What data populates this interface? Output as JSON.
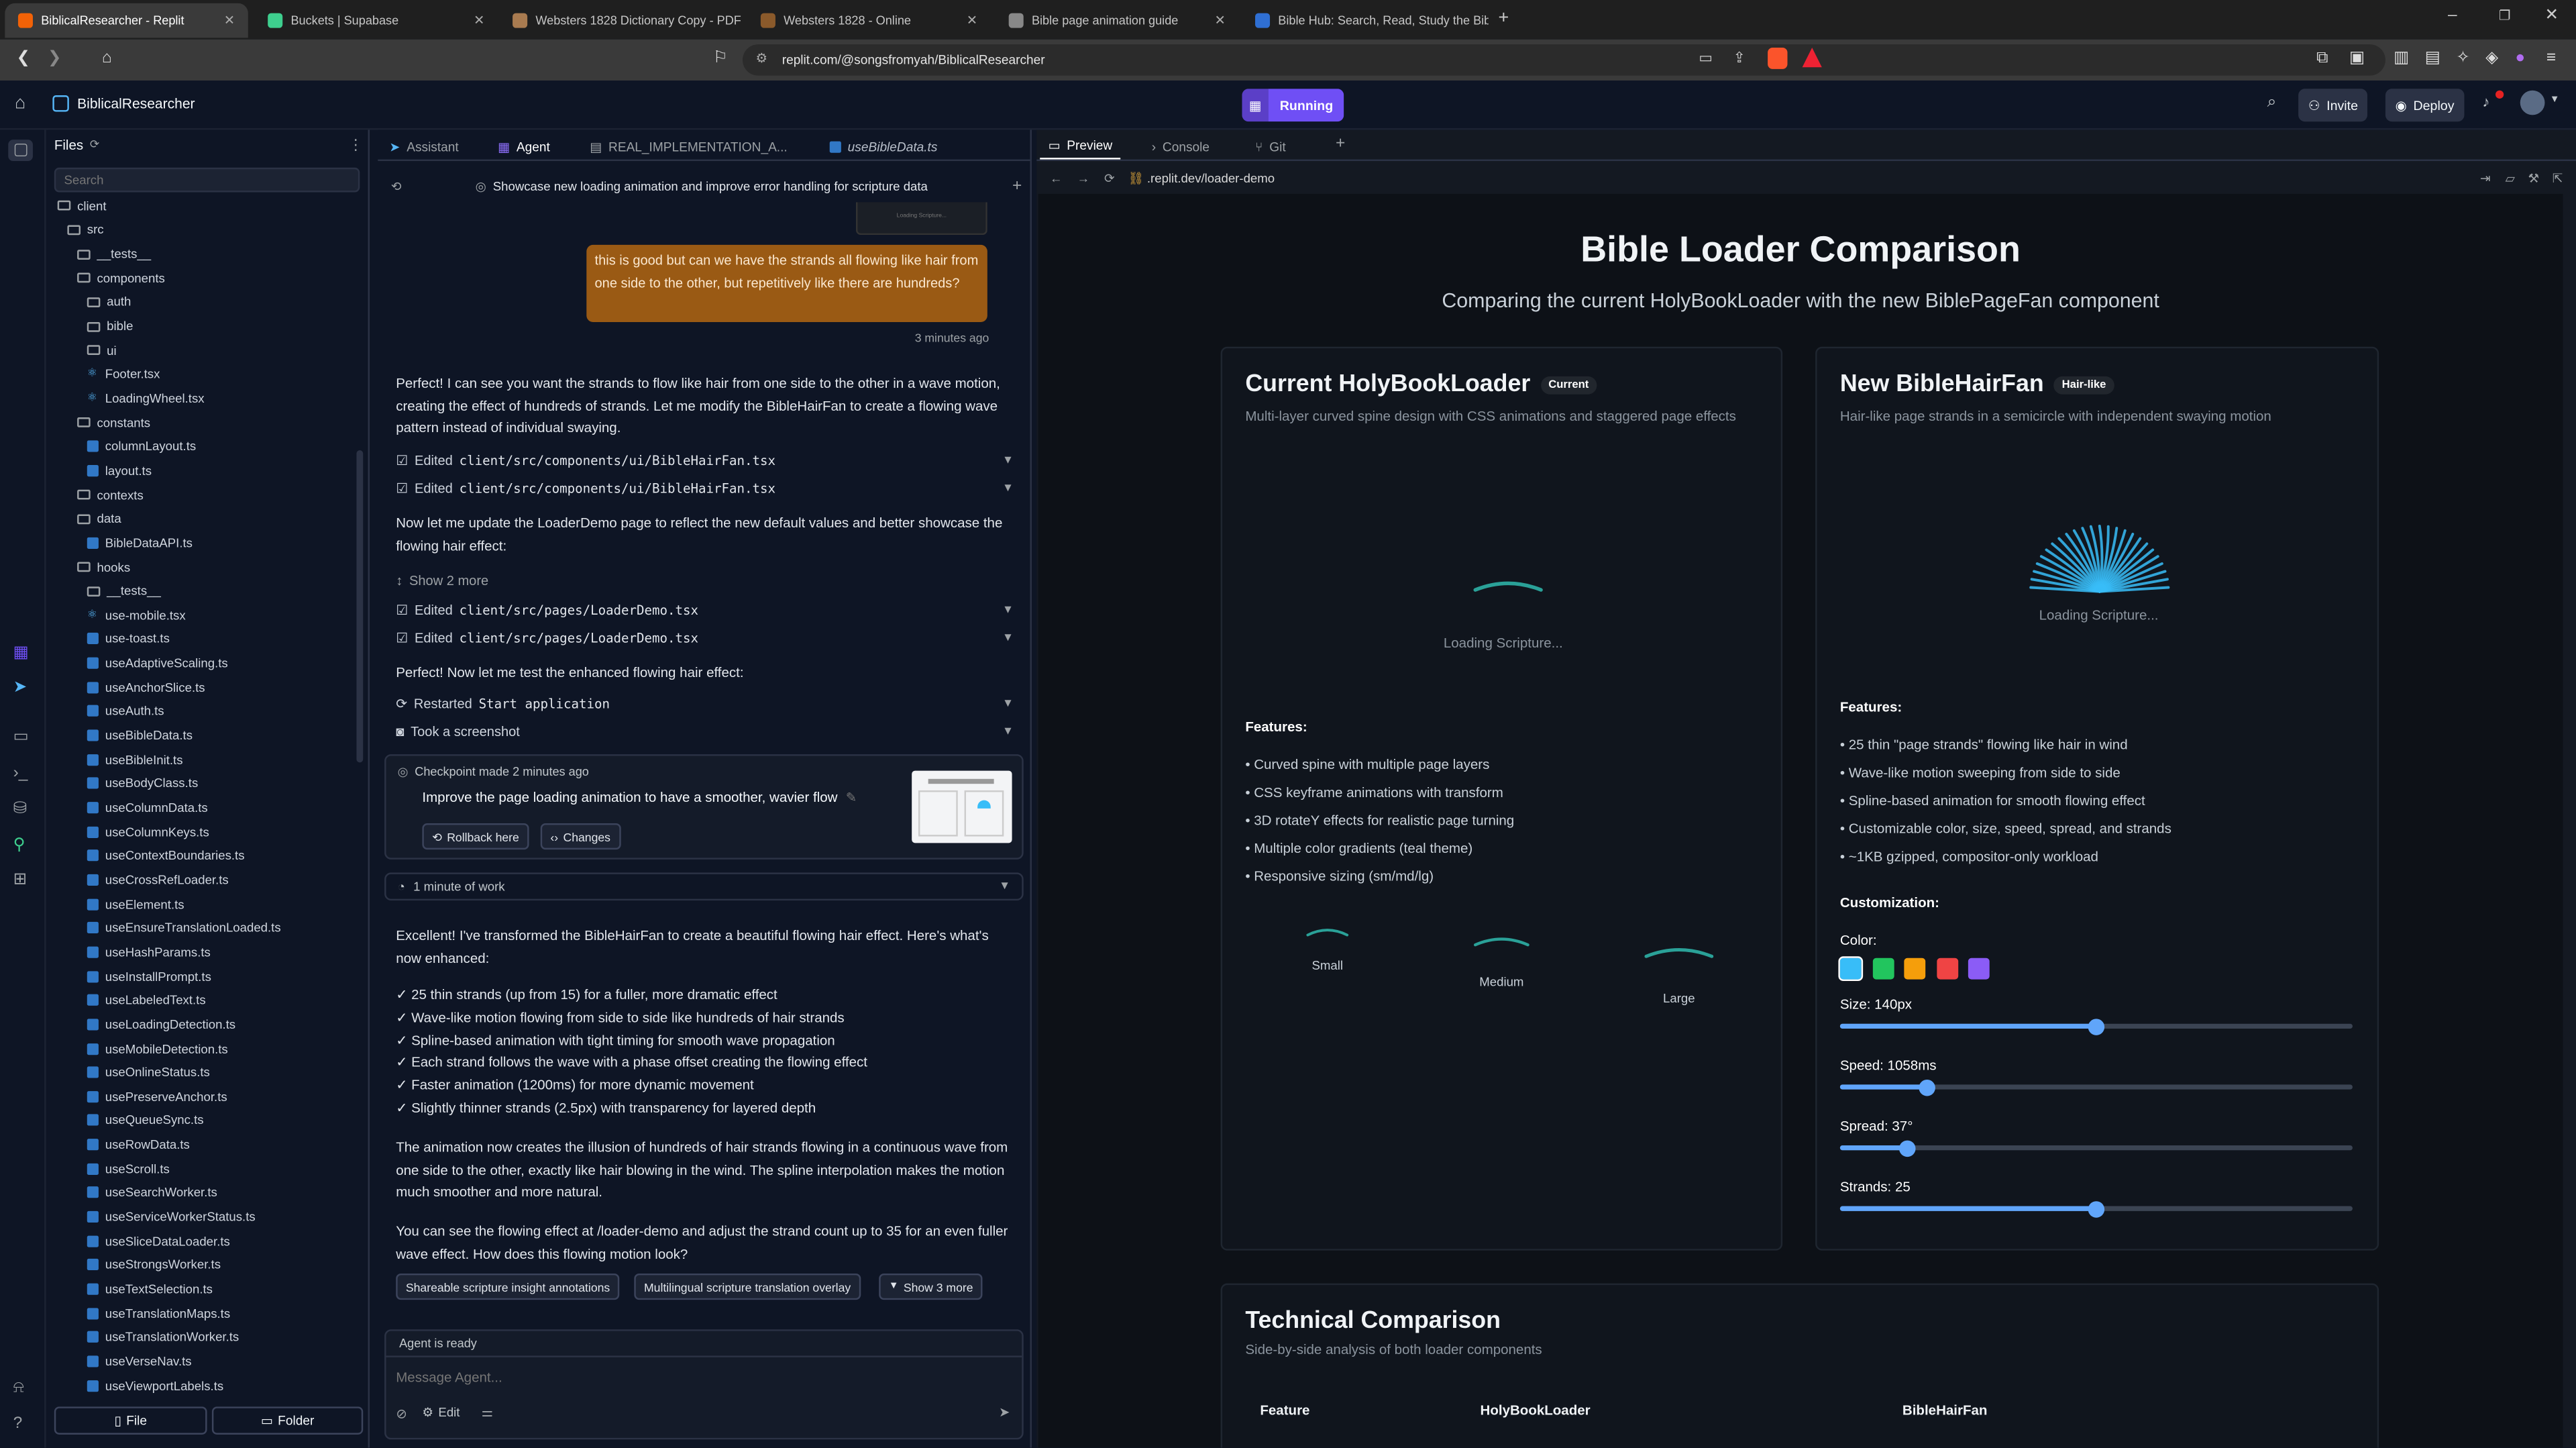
{
  "browser": {
    "tabs": [
      {
        "label": "BiblicalResearcher - Replit",
        "active": true,
        "color": "#f26207"
      },
      {
        "label": "Buckets | Supabase",
        "active": false,
        "color": "#3ecf8e"
      },
      {
        "label": "Websters 1828 Dictionary Copy - PDF",
        "active": false,
        "color": "#a97b50"
      },
      {
        "label": "Websters 1828 - Online",
        "active": false,
        "color": "#8b5a2b"
      },
      {
        "label": "Bible page animation guide",
        "active": false,
        "color": "#888888"
      },
      {
        "label": "Bible Hub: Search, Read, Study the Bible",
        "active": false,
        "color": "#2f6fd3"
      }
    ],
    "url": "replit.com/@songsfromyah/BiblicalResearcher"
  },
  "replit": {
    "project_name": "BiblicalResearcher",
    "run_label": "Running",
    "invite_label": "Invite",
    "deploy_label": "Deploy"
  },
  "files": {
    "title": "Files",
    "search_placeholder": "Search",
    "tree": [
      {
        "label": "client",
        "type": "folder",
        "depth": 0
      },
      {
        "label": "src",
        "type": "folder",
        "depth": 1
      },
      {
        "label": "__tests__",
        "type": "folder",
        "depth": 2
      },
      {
        "label": "components",
        "type": "folder",
        "depth": 2
      },
      {
        "label": "auth",
        "type": "folder",
        "depth": 3
      },
      {
        "label": "bible",
        "type": "folder",
        "depth": 3
      },
      {
        "label": "ui",
        "type": "folder",
        "depth": 3
      },
      {
        "label": "Footer.tsx",
        "type": "tsx",
        "depth": 3
      },
      {
        "label": "LoadingWheel.tsx",
        "type": "tsx",
        "depth": 3
      },
      {
        "label": "constants",
        "type": "folder",
        "depth": 2
      },
      {
        "label": "columnLayout.ts",
        "type": "ts",
        "depth": 3
      },
      {
        "label": "layout.ts",
        "type": "ts",
        "depth": 3
      },
      {
        "label": "contexts",
        "type": "folder",
        "depth": 2
      },
      {
        "label": "data",
        "type": "folder",
        "depth": 2
      },
      {
        "label": "BibleDataAPI.ts",
        "type": "ts",
        "depth": 3
      },
      {
        "label": "hooks",
        "type": "folder",
        "depth": 2
      },
      {
        "label": "__tests__",
        "type": "folder",
        "depth": 3
      },
      {
        "label": "use-mobile.tsx",
        "type": "tsx",
        "depth": 3
      },
      {
        "label": "use-toast.ts",
        "type": "ts",
        "depth": 3
      },
      {
        "label": "useAdaptiveScaling.ts",
        "type": "ts",
        "depth": 3
      },
      {
        "label": "useAnchorSlice.ts",
        "type": "ts",
        "depth": 3
      },
      {
        "label": "useAuth.ts",
        "type": "ts",
        "depth": 3
      },
      {
        "label": "useBibleData.ts",
        "type": "ts",
        "depth": 3
      },
      {
        "label": "useBibleInit.ts",
        "type": "ts",
        "depth": 3
      },
      {
        "label": "useBodyClass.ts",
        "type": "ts",
        "depth": 3
      },
      {
        "label": "useColumnData.ts",
        "type": "ts",
        "depth": 3
      },
      {
        "label": "useColumnKeys.ts",
        "type": "ts",
        "depth": 3
      },
      {
        "label": "useContextBoundaries.ts",
        "type": "ts",
        "depth": 3
      },
      {
        "label": "useCrossRefLoader.ts",
        "type": "ts",
        "depth": 3
      },
      {
        "label": "useElement.ts",
        "type": "ts",
        "depth": 3
      },
      {
        "label": "useEnsureTranslationLoaded.ts",
        "type": "ts",
        "depth": 3
      },
      {
        "label": "useHashParams.ts",
        "type": "ts",
        "depth": 3
      },
      {
        "label": "useInstallPrompt.ts",
        "type": "ts",
        "depth": 3
      },
      {
        "label": "useLabeledText.ts",
        "type": "ts",
        "depth": 3
      },
      {
        "label": "useLoadingDetection.ts",
        "type": "ts",
        "depth": 3
      },
      {
        "label": "useMobileDetection.ts",
        "type": "ts",
        "depth": 3
      },
      {
        "label": "useOnlineStatus.ts",
        "type": "ts",
        "depth": 3
      },
      {
        "label": "usePreserveAnchor.ts",
        "type": "ts",
        "depth": 3
      },
      {
        "label": "useQueueSync.ts",
        "type": "ts",
        "depth": 3
      },
      {
        "label": "useRowData.ts",
        "type": "ts",
        "depth": 3
      },
      {
        "label": "useScroll.ts",
        "type": "ts",
        "depth": 3
      },
      {
        "label": "useSearchWorker.ts",
        "type": "ts",
        "depth": 3
      },
      {
        "label": "useServiceWorkerStatus.ts",
        "type": "ts",
        "depth": 3
      },
      {
        "label": "useSliceDataLoader.ts",
        "type": "ts",
        "depth": 3
      },
      {
        "label": "useStrongsWorker.ts",
        "type": "ts",
        "depth": 3
      },
      {
        "label": "useTextSelection.ts",
        "type": "ts",
        "depth": 3
      },
      {
        "label": "useTranslationMaps.ts",
        "type": "ts",
        "depth": 3
      },
      {
        "label": "useTranslationWorker.ts",
        "type": "ts",
        "depth": 3
      },
      {
        "label": "useVerseNav.ts",
        "type": "ts",
        "depth": 3
      },
      {
        "label": "useViewportLabels.ts",
        "type": "ts",
        "depth": 3
      }
    ],
    "new_file_label": "File",
    "new_folder_label": "Folder"
  },
  "agent_panel": {
    "tabs": [
      "Assistant",
      "Agent",
      "REAL_IMPLEMENTATION_A...",
      "useBibleData.ts"
    ],
    "thread_title": "Showcase new loading animation and improve error handling for scripture data",
    "thumbnail_caption": "Loading Scripture...",
    "user_message": "this is good but can we have the strands all flowing like hair from one side to the other, but repetitively like there are hundreds?",
    "user_time": "3 minutes ago",
    "reply1": "Perfect! I can see you want the strands to flow like hair from one side to the other in a wave motion, creating the effect of hundreds of strands. Let me modify the BibleHairFan to create a flowing wave pattern instead of individual swaying.",
    "edit_prefix": "Edited",
    "edit1": "client/src/components/ui/BibleHairFan.tsx",
    "edit2": "client/src/components/ui/BibleHairFan.tsx",
    "reply2": "Now let me update the LoaderDemo page to reflect the new default values and better showcase the flowing hair effect:",
    "show_more": "Show 2 more",
    "edit3": "client/src/pages/LoaderDemo.tsx",
    "edit4": "client/src/pages/LoaderDemo.tsx",
    "reply3": "Perfect! Now let me test the enhanced flowing hair effect:",
    "restarted_prefix": "Restarted",
    "restarted_name": "Start application",
    "screenshot": "Took a screenshot",
    "checkpoint_title": "Checkpoint made 2 minutes ago",
    "checkpoint_msg": "Improve the page loading animation to have a smoother, wavier flow",
    "rollback": "Rollback here",
    "changes": "Changes",
    "work_time": "1 minute of work",
    "reply4": "Excellent! I've transformed the BibleHairFan to create a beautiful flowing hair effect. Here's what's now enhanced:",
    "bullets": [
      "✓ 25 thin strands (up from 15) for a fuller, more dramatic effect",
      "✓ Wave-like motion flowing from side to side like hundreds of hair strands",
      "✓ Spline-based animation with tight timing for smooth wave propagation",
      "✓ Each strand follows the wave with a phase offset creating the flowing effect",
      "✓ Faster animation (1200ms) for more dynamic movement",
      "✓ Slightly thinner strands (2.5px) with transparency for layered depth"
    ],
    "reply5": "The animation now creates the illusion of hundreds of hair strands flowing in a continuous wave from one side to the other, exactly like hair blowing in the wind. The spline interpolation makes the motion much smoother and more natural.",
    "reply6": "You can see the flowing effect at /loader-demo and adjust the strand count up to 35 for an even fuller wave effect. How does this flowing motion look?",
    "suggestions": [
      "Shareable scripture insight annotations",
      "Multilingual scripture translation overlay",
      "Show 3 more"
    ],
    "status": "Agent is ready",
    "input_placeholder": "Message Agent...",
    "edit_label": "Edit"
  },
  "preview_panel": {
    "tabs": [
      "Preview",
      "Console",
      "Git"
    ],
    "url": ".replit.dev/loader-demo",
    "page": {
      "title": "Bible Loader Comparison",
      "subtitle": "Comparing the current HolyBookLoader with the new BiblePageFan component",
      "left": {
        "title": "Current HolyBookLoader",
        "badge": "Current",
        "desc": "Multi-layer curved spine design with CSS animations and staggered page effects",
        "loading": "Loading Scripture...",
        "features_title": "Features:",
        "features": [
          "• Curved spine with multiple page layers",
          "• CSS keyframe animations with transform",
          "• 3D rotateY effects for realistic page turning",
          "• Multiple color gradients (teal theme)",
          "• Responsive sizing (sm/md/lg)"
        ],
        "sizes": [
          "Small",
          "Medium",
          "Large"
        ]
      },
      "right": {
        "title": "New BibleHairFan",
        "badge": "Hair-like",
        "desc": "Hair-like page strands in a semicircle with independent swaying motion",
        "loading": "Loading Scripture...",
        "features_title": "Features:",
        "features": [
          "• 25 thin \"page strands\" flowing like hair in wind",
          "• Wave-like motion sweeping from side to side",
          "• Spline-based animation for smooth flowing effect",
          "• Customizable color, size, speed, spread, and strands",
          "• ~1KB gzipped, compositor-only workload"
        ],
        "customization_title": "Customization:",
        "color_label": "Color:",
        "colors": [
          "#38bdf8",
          "#22c55e",
          "#f59e0b",
          "#ef4444",
          "#8b5cf6"
        ],
        "sliders": [
          {
            "label": "Size: 140px",
            "value": 0.5
          },
          {
            "label": "Speed: 1058ms",
            "value": 0.17
          },
          {
            "label": "Spread: 37°",
            "value": 0.13
          },
          {
            "label": "Strands: 25",
            "value": 0.5
          }
        ]
      },
      "technical": {
        "title": "Technical Comparison",
        "subtitle": "Side-by-side analysis of both loader components",
        "headers": [
          "Feature",
          "HolyBookLoader",
          "BibleHairFan"
        ]
      }
    }
  }
}
